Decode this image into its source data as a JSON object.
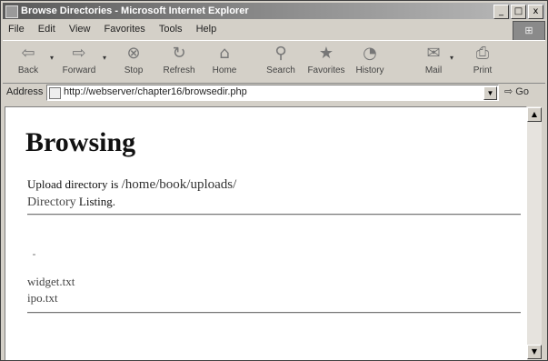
{
  "window": {
    "title": "Browse Directories - Microsoft Internet Explorer",
    "minimize": "_",
    "maximize": "□",
    "close": "x"
  },
  "menu": [
    "File",
    "Edit",
    "View",
    "Favorites",
    "Tools",
    "Help"
  ],
  "toolbar": [
    {
      "label": "Back",
      "icon": "back-arrow-icon",
      "glyph": "⇦"
    },
    {
      "label": "Forward",
      "icon": "forward-arrow-icon",
      "glyph": "⇨"
    },
    {
      "label": "Stop",
      "icon": "stop-icon",
      "glyph": "⊗"
    },
    {
      "label": "Refresh",
      "icon": "refresh-icon",
      "glyph": "↻"
    },
    {
      "label": "Home",
      "icon": "home-icon",
      "glyph": "⌂"
    },
    {
      "label": "Search",
      "icon": "search-icon",
      "glyph": "⚲"
    },
    {
      "label": "Favorites",
      "icon": "favorites-icon",
      "glyph": "★"
    },
    {
      "label": "History",
      "icon": "history-icon",
      "glyph": "◔"
    },
    {
      "label": "Mail",
      "icon": "mail-icon",
      "glyph": "✉"
    },
    {
      "label": "Print",
      "icon": "print-icon",
      "glyph": "⎙"
    }
  ],
  "address": {
    "label": "Address",
    "url": "http://webserver/chapter16/browsedir.php",
    "go": "Go"
  },
  "page": {
    "heading": "Browsing",
    "upload_prefix": "Upload directory is ",
    "upload_path": "/home/book/uploads/",
    "listing_dir": "Directory",
    "listing_rest": " Listing.",
    "files": [
      "widget.txt",
      "ipo.txt"
    ]
  }
}
